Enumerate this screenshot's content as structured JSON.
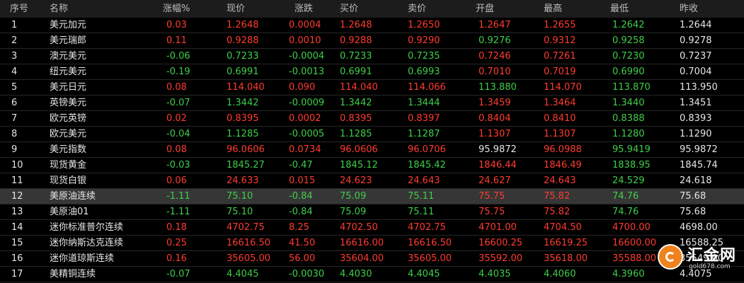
{
  "headers": [
    "序号",
    "名称",
    "涨幅%",
    "现价",
    "涨跌",
    "买价",
    "卖价",
    "开盘",
    "最高",
    "最低",
    "昨收"
  ],
  "rows": [
    {
      "n": "1",
      "name": "美元加元",
      "chg_pct": "0.03",
      "price": "1.2648",
      "chg": "0.0004",
      "bid": "1.2648",
      "ask": "1.2650",
      "open": "1.2647",
      "high": "1.2655",
      "low": "1.2642",
      "prev": "1.2644",
      "dir": "up",
      "open_dir": "up",
      "high_dir": "up",
      "low_dir": "down"
    },
    {
      "n": "2",
      "name": "美元瑞郎",
      "chg_pct": "0.11",
      "price": "0.9288",
      "chg": "0.0010",
      "bid": "0.9288",
      "ask": "0.9290",
      "open": "0.9276",
      "high": "0.9312",
      "low": "0.9258",
      "prev": "0.9278",
      "dir": "up",
      "open_dir": "down",
      "high_dir": "up",
      "low_dir": "down"
    },
    {
      "n": "3",
      "name": "澳元美元",
      "chg_pct": "-0.06",
      "price": "0.7233",
      "chg": "-0.0004",
      "bid": "0.7233",
      "ask": "0.7235",
      "open": "0.7246",
      "high": "0.7261",
      "low": "0.7230",
      "prev": "0.7237",
      "dir": "down",
      "open_dir": "up",
      "high_dir": "up",
      "low_dir": "down"
    },
    {
      "n": "4",
      "name": "纽元美元",
      "chg_pct": "-0.19",
      "price": "0.6991",
      "chg": "-0.0013",
      "bid": "0.6991",
      "ask": "0.6993",
      "open": "0.7010",
      "high": "0.7019",
      "low": "0.6990",
      "prev": "0.7004",
      "dir": "down",
      "open_dir": "up",
      "high_dir": "up",
      "low_dir": "down"
    },
    {
      "n": "5",
      "name": "美元日元",
      "chg_pct": "0.08",
      "price": "114.040",
      "chg": "0.090",
      "bid": "114.040",
      "ask": "114.066",
      "open": "113.880",
      "high": "114.070",
      "low": "113.870",
      "prev": "113.950",
      "dir": "up",
      "open_dir": "down",
      "high_dir": "up",
      "low_dir": "down"
    },
    {
      "n": "6",
      "name": "英镑美元",
      "chg_pct": "-0.07",
      "price": "1.3442",
      "chg": "-0.0009",
      "bid": "1.3442",
      "ask": "1.3444",
      "open": "1.3459",
      "high": "1.3464",
      "low": "1.3440",
      "prev": "1.3451",
      "dir": "down",
      "open_dir": "up",
      "high_dir": "up",
      "low_dir": "down"
    },
    {
      "n": "7",
      "name": "欧元英镑",
      "chg_pct": "0.02",
      "price": "0.8395",
      "chg": "0.0002",
      "bid": "0.8395",
      "ask": "0.8397",
      "open": "0.8404",
      "high": "0.8410",
      "low": "0.8388",
      "prev": "0.8393",
      "dir": "up",
      "open_dir": "up",
      "high_dir": "up",
      "low_dir": "down"
    },
    {
      "n": "8",
      "name": "欧元美元",
      "chg_pct": "-0.04",
      "price": "1.1285",
      "chg": "-0.0005",
      "bid": "1.1285",
      "ask": "1.1287",
      "open": "1.1307",
      "high": "1.1307",
      "low": "1.1280",
      "prev": "1.1290",
      "dir": "down",
      "open_dir": "up",
      "high_dir": "up",
      "low_dir": "down"
    },
    {
      "n": "9",
      "name": "美元指数",
      "chg_pct": "0.08",
      "price": "96.0606",
      "chg": "0.0734",
      "bid": "96.0606",
      "ask": "96.0706",
      "open": "95.9872",
      "high": "96.0988",
      "low": "95.9419",
      "prev": "95.9872",
      "dir": "up",
      "open_dir": "flat",
      "high_dir": "up",
      "low_dir": "down"
    },
    {
      "n": "10",
      "name": "现货黄金",
      "chg_pct": "-0.03",
      "price": "1845.27",
      "chg": "-0.47",
      "bid": "1845.12",
      "ask": "1845.42",
      "open": "1846.44",
      "high": "1846.49",
      "low": "1838.95",
      "prev": "1845.74",
      "dir": "down",
      "open_dir": "up",
      "high_dir": "up",
      "low_dir": "down"
    },
    {
      "n": "11",
      "name": "现货白银",
      "chg_pct": "0.06",
      "price": "24.633",
      "chg": "0.015",
      "bid": "24.623",
      "ask": "24.643",
      "open": "24.627",
      "high": "24.643",
      "low": "24.529",
      "prev": "24.618",
      "dir": "up",
      "open_dir": "up",
      "high_dir": "up",
      "low_dir": "down"
    },
    {
      "n": "12",
      "name": "美原油连续",
      "chg_pct": "-1.11",
      "price": "75.10",
      "chg": "-0.84",
      "bid": "75.09",
      "ask": "75.11",
      "open": "75.75",
      "high": "75.82",
      "low": "74.76",
      "prev": "75.68",
      "dir": "down",
      "open_dir": "up",
      "high_dir": "up",
      "low_dir": "down",
      "selected": true
    },
    {
      "n": "13",
      "name": "美原油01",
      "chg_pct": "-1.11",
      "price": "75.10",
      "chg": "-0.84",
      "bid": "75.09",
      "ask": "75.11",
      "open": "75.75",
      "high": "75.82",
      "low": "74.76",
      "prev": "75.68",
      "dir": "down",
      "open_dir": "up",
      "high_dir": "up",
      "low_dir": "down"
    },
    {
      "n": "14",
      "name": "迷你标准普尔连续",
      "chg_pct": "0.18",
      "price": "4702.75",
      "chg": "8.25",
      "bid": "4702.50",
      "ask": "4702.75",
      "open": "4701.00",
      "high": "4704.50",
      "low": "4700.00",
      "prev": "4698.00",
      "dir": "up",
      "open_dir": "up",
      "high_dir": "up",
      "low_dir": "up"
    },
    {
      "n": "15",
      "name": "迷你纳斯达克连续",
      "chg_pct": "0.25",
      "price": "16616.50",
      "chg": "41.50",
      "bid": "16616.00",
      "ask": "16616.50",
      "open": "16600.25",
      "high": "16619.25",
      "low": "16600.00",
      "prev": "16588.25",
      "dir": "up",
      "open_dir": "up",
      "high_dir": "up",
      "low_dir": "up"
    },
    {
      "n": "16",
      "name": "迷你道琼斯连续",
      "chg_pct": "0.16",
      "price": "35605.00",
      "chg": "56.00",
      "bid": "35604.00",
      "ask": "35605.00",
      "open": "35592.00",
      "high": "35618.00",
      "low": "35588.00",
      "prev": "35549.00",
      "dir": "up",
      "open_dir": "up",
      "high_dir": "up",
      "low_dir": "up"
    },
    {
      "n": "17",
      "name": "美精铜连续",
      "chg_pct": "-0.07",
      "price": "4.4045",
      "chg": "-0.0030",
      "bid": "4.4030",
      "ask": "4.4045",
      "open": "4.4035",
      "high": "4.4060",
      "low": "4.3960",
      "prev": "4.4075",
      "dir": "down",
      "open_dir": "down",
      "high_dir": "down",
      "low_dir": "down"
    }
  ],
  "colors": {
    "up": "#ff3b30",
    "down": "#3fcd4a",
    "flat": "#e6e6e6",
    "header_bg": "#1c1c1c",
    "selected_bg": "#363636"
  },
  "logo": {
    "name": "汇金网",
    "url": "gold678.com"
  }
}
